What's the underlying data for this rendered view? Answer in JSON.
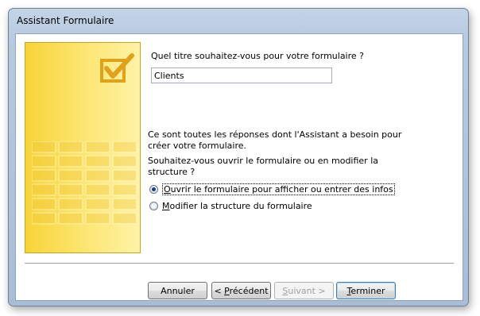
{
  "window": {
    "title": "Assistant Formulaire"
  },
  "form": {
    "title_question": "Quel titre souhaitez-vous pour votre formulaire ?",
    "title_value": "Clients",
    "info_line1": "Ce sont toutes les réponses dont l'Assistant a besoin pour",
    "info_line2": "créer votre formulaire.",
    "open_question_line1": "Souhaitez-vous ouvrir le formulaire ou en modifier la",
    "open_question_line2": "structure ?",
    "options": [
      {
        "accesskey": "O",
        "rest": "uvrir le formulaire pour afficher ou entrer des infos",
        "checked": true
      },
      {
        "accesskey": "M",
        "rest": "odifier la structure du formulaire",
        "checked": false
      }
    ]
  },
  "buttons": {
    "cancel": "Annuler",
    "previous_prefix": "< ",
    "previous_key": "P",
    "previous_rest": "récédent",
    "next_key": "S",
    "next_rest": "uivant >",
    "finish_key": "T",
    "finish_rest": "erminer"
  },
  "colors": {
    "panel_yellow": "#f7d338",
    "frame_blue": "#b7cadf",
    "focus_border": "#3c7fb1"
  },
  "icons": {
    "checkbox_decoration": "checkbox-check-icon",
    "grid_decoration": "form-grid-icon"
  }
}
